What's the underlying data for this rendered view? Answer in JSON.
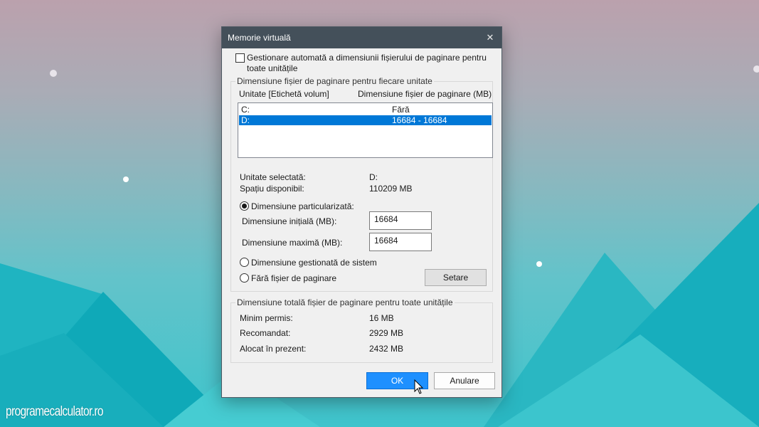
{
  "watermark": "programecalculator.ro",
  "dialog": {
    "title": "Memorie virtuală",
    "close_icon": "close-icon",
    "auto_manage_label_line1": "Gestionare automată a dimensiunii fișierului de paginare pentru",
    "auto_manage_label_line2": "toate unitățile",
    "auto_manage_checked": false,
    "per_drive_group": {
      "title": "Dimensiune fișier de paginare pentru fiecare unitate",
      "col_drive": "Unitate [Etichetă volum]",
      "col_size": "Dimensiune fișier de paginare (MB)",
      "rows": [
        {
          "drive": "C:",
          "size": "Fără",
          "selected": false
        },
        {
          "drive": "D:",
          "size": "16684 - 16684",
          "selected": true
        }
      ],
      "selected_drive_label": "Unitate selectată:",
      "selected_drive_value": "D:",
      "free_space_label": "Spațiu disponibil:",
      "free_space_value": "110209 MB",
      "custom_size_label": "Dimensiune particularizată:",
      "custom_size_selected": true,
      "initial_size_label": "Dimensiune inițială (MB):",
      "initial_size_value": "16684",
      "max_size_label": "Dimensiune maximă (MB):",
      "max_size_value": "16684",
      "system_managed_label": "Dimensiune gestionată de sistem",
      "no_paging_label": "Fără fișier de paginare",
      "set_button": "Setare"
    },
    "total_group": {
      "title": "Dimensiune totală fișier de paginare pentru toate unitățile",
      "min_label": "Minim permis:",
      "min_value": "16 MB",
      "recommended_label": "Recomandat:",
      "recommended_value": "2929 MB",
      "allocated_label": "Alocat în prezent:",
      "allocated_value": "2432 MB"
    },
    "ok_button": "OK",
    "cancel_button": "Anulare"
  },
  "colors": {
    "titlebar": "#44505a",
    "selection": "#0078d7",
    "ok_button": "#1e90ff"
  }
}
